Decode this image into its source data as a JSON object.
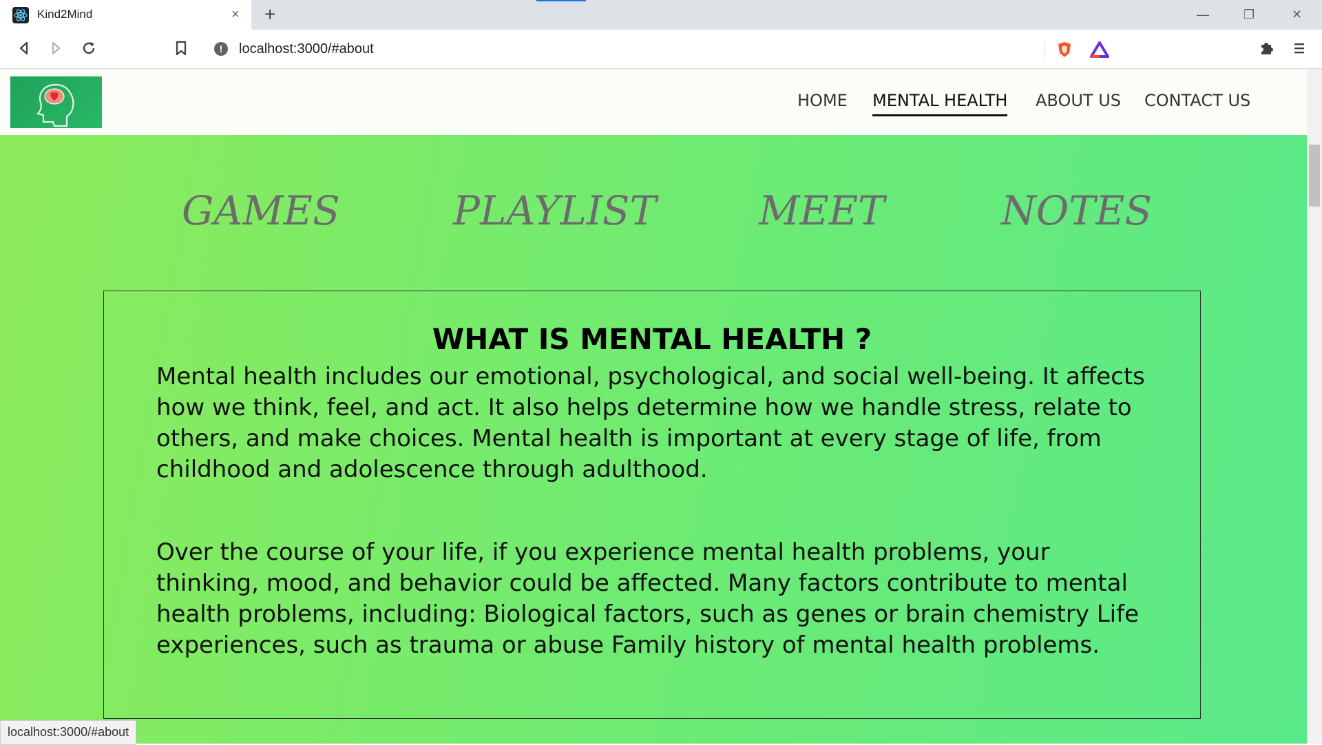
{
  "browser": {
    "tab_title": "Kind2Mind",
    "tab_close": "×",
    "new_tab": "+",
    "url": "localhost:3000/#about",
    "status_url": "localhost:3000/#about",
    "window_controls": {
      "minimize": "—",
      "restore": "❐",
      "close": "✕"
    }
  },
  "nav": {
    "items": [
      {
        "label": "HOME",
        "active": false
      },
      {
        "label": "MENTAL HEALTH",
        "active": true
      },
      {
        "label": "ABOUT US",
        "active": false
      },
      {
        "label": "CONTACT US",
        "active": false
      }
    ]
  },
  "features": [
    {
      "label": "GAMES"
    },
    {
      "label": "PLAYLIST"
    },
    {
      "label": "MEET"
    },
    {
      "label": "NOTES"
    }
  ],
  "info": {
    "title": "WHAT IS MENTAL HEALTH ?",
    "paragraphs": [
      "Mental health includes our emotional, psychological, and social well-being. It affects how we think, feel, and act. It also helps determine how we handle stress, relate to others, and make choices. Mental health is important at every stage of life, from childhood and adolescence through adulthood.",
      "Over the course of your life, if you experience mental health problems, your thinking, mood, and behavior could be affected. Many factors contribute to mental health problems, including: Biological factors, such as genes or brain chemistry Life experiences, such as trauma or abuse Family history of mental health problems."
    ]
  },
  "colors": {
    "hero_start": "#8deb5b",
    "hero_end": "#5ae98a",
    "feature_text": "#6c6c6c",
    "logo_bg": "#1fa25a"
  }
}
